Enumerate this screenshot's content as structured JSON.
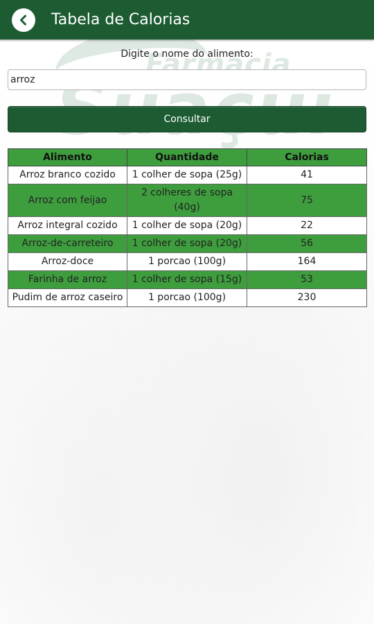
{
  "appbar": {
    "title": "Tabela de Calorias",
    "back_icon": "chevron-left-icon"
  },
  "watermark": {
    "line1": "Farmácia",
    "line2": "Suaçuí"
  },
  "form": {
    "prompt": "Digite o nome do alimento:",
    "search_value": "arroz",
    "button_label": "Consultar"
  },
  "table": {
    "headers": [
      "Alimento",
      "Quantidade",
      "Calorias"
    ],
    "rows": [
      {
        "alimento": "Arroz branco cozido",
        "quantidade": "1 colher de sopa (25g)",
        "calorias": "41"
      },
      {
        "alimento": "Arroz com feijao",
        "quantidade": "2 colheres de sopa (40g)",
        "calorias": "75"
      },
      {
        "alimento": "Arroz integral cozido",
        "quantidade": "1 colher de sopa (20g)",
        "calorias": "22"
      },
      {
        "alimento": "Arroz-de-carreteiro",
        "quantidade": "1 colher de sopa (20g)",
        "calorias": "56"
      },
      {
        "alimento": "Arroz-doce",
        "quantidade": "1 porcao (100g)",
        "calorias": "164"
      },
      {
        "alimento": "Farinha de arroz",
        "quantidade": "1 colher de sopa (15g)",
        "calorias": "53"
      },
      {
        "alimento": "Pudim de arroz caseiro",
        "quantidade": "1 porcao (100g)",
        "calorias": "230"
      }
    ]
  },
  "colors": {
    "appbar": "#1d5c33",
    "table_header": "#3e9e3e",
    "row_alt": "#3e9e3e",
    "row_default": "#ffffff"
  }
}
